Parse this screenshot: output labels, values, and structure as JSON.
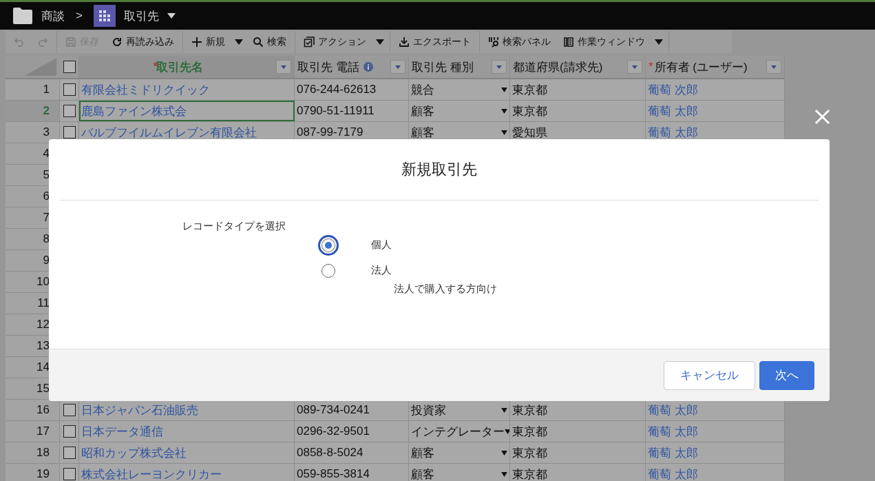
{
  "breadcrumb": {
    "folder": "商談",
    "separator": ">",
    "current": "取引先"
  },
  "toolbar": {
    "groups": [
      [
        {
          "kind": "undo",
          "disabled": true
        },
        {
          "kind": "redo",
          "disabled": true
        }
      ],
      [
        {
          "kind": "save",
          "label": "保存",
          "disabled": true
        },
        {
          "kind": "reload",
          "label": "再読み込み",
          "disabled": false
        }
      ],
      [
        {
          "kind": "plus",
          "label": "新規",
          "disabled": false,
          "dropdown": true
        },
        {
          "kind": "search",
          "label": "検索",
          "disabled": false
        }
      ],
      [
        {
          "kind": "action",
          "label": "アクション",
          "disabled": false,
          "dropdown": true
        }
      ],
      [
        {
          "kind": "export",
          "label": "エクスポート",
          "disabled": false
        }
      ],
      [
        {
          "kind": "panel",
          "label": "検索パネル",
          "disabled": false
        },
        {
          "kind": "window",
          "label": "作業ウィンドウ",
          "disabled": false,
          "dropdown": true
        }
      ]
    ]
  },
  "table": {
    "select_all_checked": false,
    "columns": [
      {
        "marker": "*",
        "label": "取引先名"
      },
      {
        "label": "取引先 電話",
        "info": true
      },
      {
        "label": "取引先 種別"
      },
      {
        "label": "都道府県(請求先)"
      },
      {
        "marker": "*",
        "label": "所有者 (ユーザー)"
      }
    ],
    "rows": [
      {
        "number": "1",
        "selected": false,
        "checked": false,
        "name": "有限会社ミドリクイック",
        "phone": "076-244-62613",
        "type": "競合",
        "prefecture": "東京都",
        "owner": "葡萄 次郎"
      },
      {
        "number": "2",
        "selected": true,
        "checked": false,
        "name": "鹿島ファイン株式会",
        "phone": "0790-51-11911",
        "type": "顧客",
        "prefecture": "東京都",
        "owner": "葡萄 太郎"
      },
      {
        "number": "3",
        "selected": false,
        "checked": false,
        "name": "バルブフイルムイレブン有限会社",
        "phone": "087-99-7179",
        "type": "顧客",
        "prefecture": "愛知県",
        "owner": "葡萄 太郎"
      },
      {
        "number": "4",
        "selected": false
      },
      {
        "number": "5",
        "selected": false
      },
      {
        "number": "6",
        "selected": false
      },
      {
        "number": "7",
        "selected": false
      },
      {
        "number": "8",
        "selected": false
      },
      {
        "number": "9",
        "selected": false
      },
      {
        "number": "10",
        "selected": false
      },
      {
        "number": "11",
        "selected": false
      },
      {
        "number": "12",
        "selected": false
      },
      {
        "number": "13",
        "selected": false
      },
      {
        "number": "14",
        "selected": false
      },
      {
        "number": "15",
        "selected": false
      },
      {
        "number": "16",
        "selected": false,
        "checked": false,
        "name": "日本ジャパン石油販売",
        "phone": "089-734-0241",
        "type": "投資家",
        "prefecture": "東京都",
        "owner": "葡萄 太郎"
      },
      {
        "number": "17",
        "selected": false,
        "checked": false,
        "name": "日本データ通信",
        "phone": "0296-32-9501",
        "type": "インテグレーター",
        "prefecture": "東京都",
        "owner": "葡萄 太郎"
      },
      {
        "number": "18",
        "selected": false,
        "checked": false,
        "name": "昭和カップ株式会社",
        "phone": "0858-8-5024",
        "type": "顧客",
        "prefecture": "東京都",
        "owner": "葡萄 太郎"
      },
      {
        "number": "19",
        "selected": false,
        "checked": false,
        "name": "株式会社レーヨンクリカー",
        "phone": "059-855-3814",
        "type": "顧客",
        "prefecture": "東京都",
        "owner": "葡萄 太郎"
      }
    ]
  },
  "dialog": {
    "title": "新規取引先",
    "prompt": "レコードタイプを選択",
    "options": [
      {
        "label": "個人",
        "selected": true
      },
      {
        "label": "法人",
        "selected": false,
        "description": "法人で購入する方向け"
      }
    ],
    "buttons": [
      {
        "label": "キャンセル",
        "kind": "secondary"
      },
      {
        "label": "次へ",
        "kind": "primary"
      }
    ]
  }
}
